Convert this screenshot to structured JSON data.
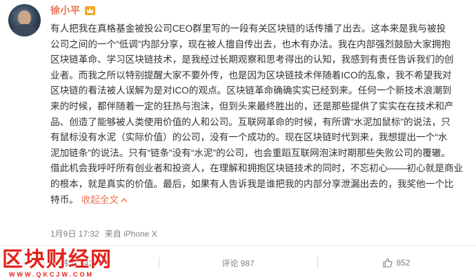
{
  "user": {
    "name": "徐小平",
    "badge_icon": "vip-crown-icon",
    "badge_color": "#f5a623"
  },
  "post": {
    "text": "有人把我在真格基金被投公司CEO群里写的一段有关区块链的话传播了出去。这本来是我与被投公司之间的一个“低调”内部分享，现在被人擅自传出去，也木有办法。我在内部强烈鼓励大家拥抱区块链革命、学习区块链技术，是我经过长期观察和思考得出的认知，我感到有责任告诉我们的创业者。而我之所以特别提醒大家不要外传，也是因为区块链技术伴随着ICO的乱象，我不希望我对区块链的看法被人误解为是对ICO的观点。区块链革命确确实实已经到来。任何一个新技术浪潮到来的时候，都伴随着一定的狂热与泡沫，但到头来最终胜出的，还是那些提供了实实在在技术和产品、创造了能够被人类使用价值的人和公司。互联网革命的时候，有所谓“水泥加鼠标”的说法，只有鼠标没有水泥（实际价值）的公司，没有一个成功的。现在区块链时代到来，我想提出一个“水泥加链条”的说法。只有“链条”没有“水泥”的公司，也会重蹈互联网泡沫时期那些失败公司的覆辙。借此机会我呼吁所有创业者和投资人，在理解和拥抱区块链技术的同时，不忘初心——初心就是商业的根本，就是真实的价值。最后，如果有人告诉我是谁把我的内部分享泄漏出去的，我奖他一个比特币。",
    "lines": [
      "有人把我在真格基金被投公司CEO群里写的一段有关区块链的话传播了出去。这本来是我与被投",
      "公司之间的一个“低调”内部分享，现在被人擅自传出去，也木有办法。我在内部强烈鼓励大家拥抱",
      "区块链革命、学习区块链技术，是我经过长期观察和思考得出的认知，我感到有责任告诉我们的创",
      "业者。而我之所以特别提醒大家不要外传，也是因为区块链技术伴随着ICO的乱象，我不希望我对",
      "区块链的看法被人误解为是对ICO的观点。区块链革命确确实实已经到来。任何一个新技术浪潮到",
      "来的时候，都伴随着一定的狂热与泡沫，但到头来最终胜出的，还是那些提供了实实在在技术和产",
      "品、创造了能够被人类使用价值的人和公司。互联网革命的时候，有所谓“水泥加鼠标”的说法，只",
      "有鼠标没有水泥（实际价值）的公司，没有一个成功的。现在区块链时代到来，我想提出一个“水",
      "泥加链条”的说法。只有“链条”没有“水泥”的公司，也会重蹈互联网泡沫时期那些失败公司的覆辙。",
      "借此机会我呼吁所有创业者和投资人，在理解和拥抱区块链技术的同时，不忘初心——初心就是商业",
      "的根本，就是真实的价值。最后，如果有人告诉我是谁把我的内部分享泄漏出去的，我奖他一个比",
      "特币。"
    ],
    "collapse_label": "收起全文",
    "collapse_icon": "collapse-up-icon"
  },
  "meta": {
    "timestamp": "1月9日 17:32",
    "source": "来自 iPhone X"
  },
  "actions": {
    "repost_label": "转发 1427",
    "comment_label": "评论 987",
    "like_count": "852",
    "like_icon": "thumbs-up-icon"
  },
  "watermark": {
    "brand": "区块财经网",
    "url": "WWW.QKCJW.COM",
    "color": "#e2231a"
  },
  "colors": {
    "accent": "#eb7350",
    "text": "#333333",
    "muted": "#808080"
  }
}
